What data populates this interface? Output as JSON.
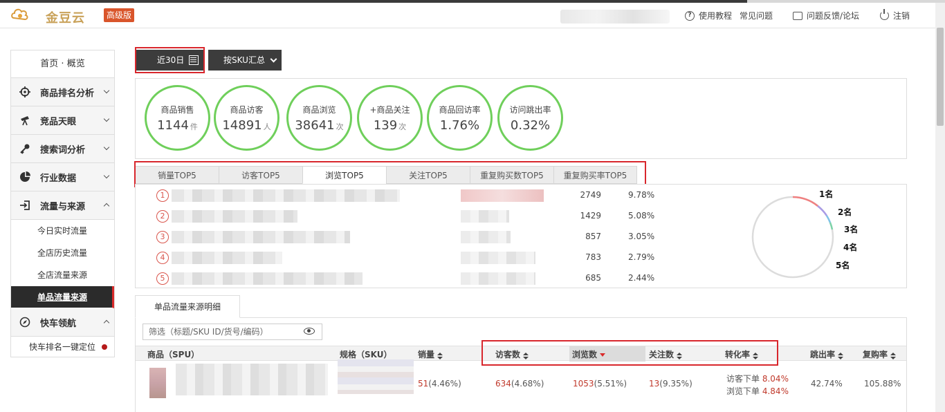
{
  "header": {
    "logo_text": "金豆云",
    "edition_badge": "高级版",
    "links": [
      {
        "label": "使用教程",
        "icon": "question-icon"
      },
      {
        "label": "常见问题",
        "icon": ""
      },
      {
        "label": "问题反馈/论坛",
        "icon": "chat-icon"
      },
      {
        "label": "注销",
        "icon": "power-icon"
      }
    ]
  },
  "sidebar": {
    "home": "首页 · 概览",
    "groups": [
      {
        "label": "商品排名分析",
        "icon": "crosshair-icon"
      },
      {
        "label": "竞品天眼",
        "icon": "telescope-icon"
      },
      {
        "label": "搜索词分析",
        "icon": "key-icon"
      },
      {
        "label": "行业数据",
        "icon": "pie-chart-icon"
      },
      {
        "label": "流量与来源",
        "icon": "login-icon"
      },
      {
        "label": "快车领航",
        "icon": "compass-icon"
      }
    ],
    "traffic_sub": [
      "今日实时流量",
      "全店历史流量",
      "全店流量来源",
      "单品流量来源"
    ],
    "express_sub": "快车排名一键定位"
  },
  "controls": {
    "date_range": "近30日",
    "group_by": "按SKU汇总"
  },
  "metrics": [
    {
      "label": "商品销售",
      "value": "1144",
      "unit": "件"
    },
    {
      "label": "商品访客",
      "value": "14891",
      "unit": "人"
    },
    {
      "label": "商品浏览",
      "value": "38641",
      "unit": "次"
    },
    {
      "label": "+商品关注",
      "value": "139",
      "unit": "次"
    },
    {
      "label": "商品回访率",
      "value": "1.76%",
      "unit": ""
    },
    {
      "label": "访问跳出率",
      "value": "0.32%",
      "unit": ""
    }
  ],
  "tabs": [
    "销量TOP5",
    "访客TOP5",
    "浏览TOP5",
    "关注TOP5",
    "重复购买数TOP5",
    "重复购买率TOP5"
  ],
  "active_tab": 2,
  "top5": [
    {
      "rank": "1",
      "count": "2749",
      "pct": "9.78%"
    },
    {
      "rank": "2",
      "count": "1429",
      "pct": "5.08%"
    },
    {
      "rank": "3",
      "count": "857",
      "pct": "3.05%"
    },
    {
      "rank": "4",
      "count": "783",
      "pct": "2.79%"
    },
    {
      "rank": "5",
      "count": "685",
      "pct": "2.44%"
    }
  ],
  "donut_labels": [
    "1名",
    "2名",
    "3名",
    "4名",
    "5名"
  ],
  "donut_colors": [
    "#f08080",
    "#a99be6",
    "#7fc3e8",
    "#7dd3a8",
    "#dcdcdc"
  ],
  "detail": {
    "tab_label": "单品流量来源明细",
    "filter_placeholder": "筛选（标题/SKU ID/货号/编码）",
    "columns": [
      "商品（SPU）",
      "规格（SKU）",
      "销量",
      "访客数",
      "浏览数",
      "关注数",
      "转化率",
      "跳出率",
      "复购率"
    ],
    "row": {
      "sales": "51",
      "sales_pct": "(4.46%)",
      "visitors": "634",
      "visitors_pct": "(4.68%)",
      "views": "1053",
      "views_pct": "(5.51%)",
      "follows": "13",
      "follows_pct": "(9.35%)",
      "conv_visit_label": "访客下单",
      "conv_visit": "8.04%",
      "conv_view_label": "浏览下单",
      "conv_view": "4.84%",
      "bounce": "42.74%",
      "repurchase": "105.88%"
    }
  }
}
